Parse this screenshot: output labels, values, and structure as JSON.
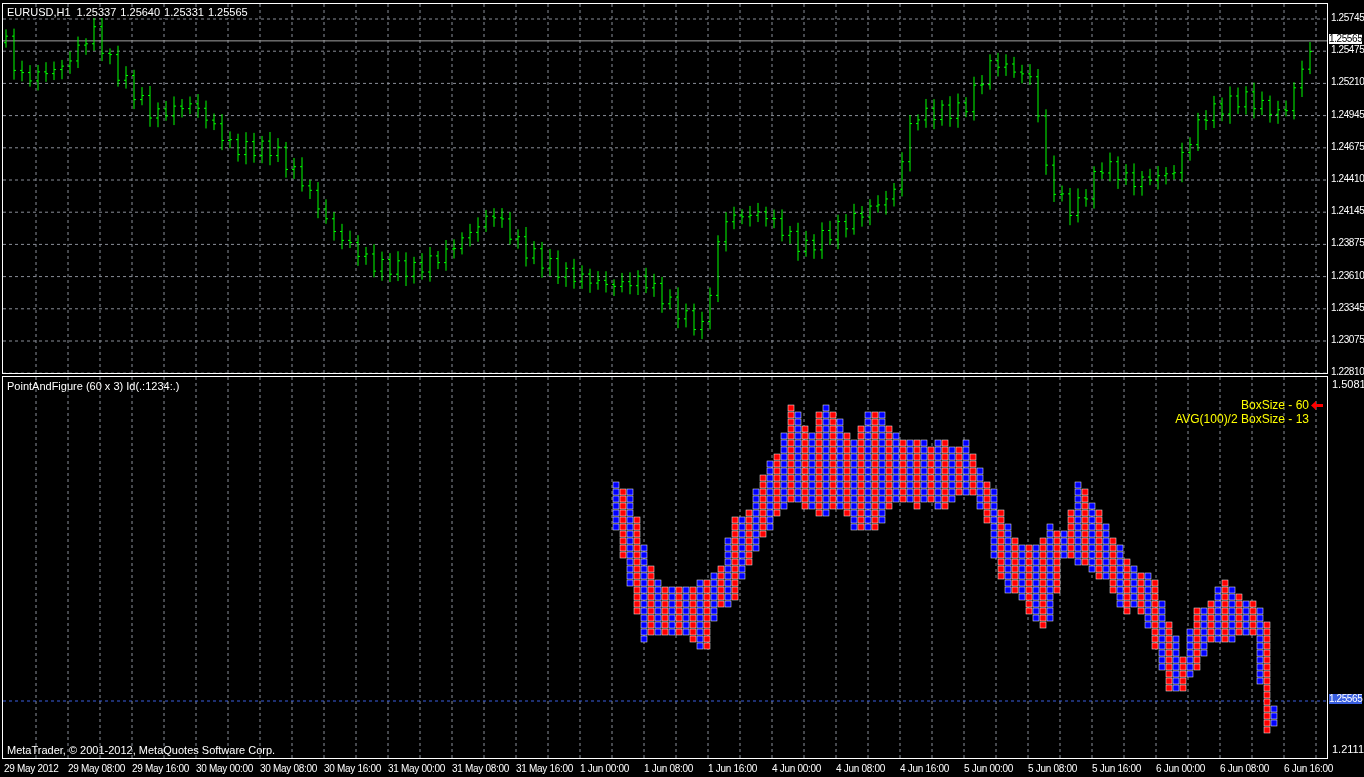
{
  "price_chart": {
    "symbol": "EURUSD,H1",
    "quote": [
      "1.25337",
      "1.25640",
      "1.25331",
      "1.25565"
    ],
    "price_axis": [
      "1.25745",
      "1.25475",
      "1.25210",
      "1.24945",
      "1.24675",
      "1.24410",
      "1.24145",
      "1.23875",
      "1.23610",
      "1.23345",
      "1.23075",
      "1.22810"
    ],
    "current_price": "1.25565"
  },
  "indicator": {
    "title": "PointAndFigure (60 x 3) Id(.:1234:.)",
    "labels": [
      "BoxSize - 60",
      "AVG(100)/2 BoxSize - 13"
    ],
    "axis_max": "1.5081",
    "axis_min": "1.2111",
    "current_price": "1.25565"
  },
  "copyright": "MetaTrader, © 2001-2012, MetaQuotes Software Corp.",
  "time_axis": [
    "29 May 2012",
    "29 May 08:00",
    "29 May 16:00",
    "30 May 00:00",
    "30 May 08:00",
    "30 May 16:00",
    "31 May 00:00",
    "31 May 08:00",
    "31 May 16:00",
    "1 Jun 00:00",
    "1 Jun 08:00",
    "1 Jun 16:00",
    "4 Jun 00:00",
    "4 Jun 08:00",
    "4 Jun 16:00",
    "5 Jun 00:00",
    "5 Jun 08:00",
    "5 Jun 16:00",
    "6 Jun 00:00",
    "6 Jun 08:00",
    "6 Jun 16:00"
  ]
}
